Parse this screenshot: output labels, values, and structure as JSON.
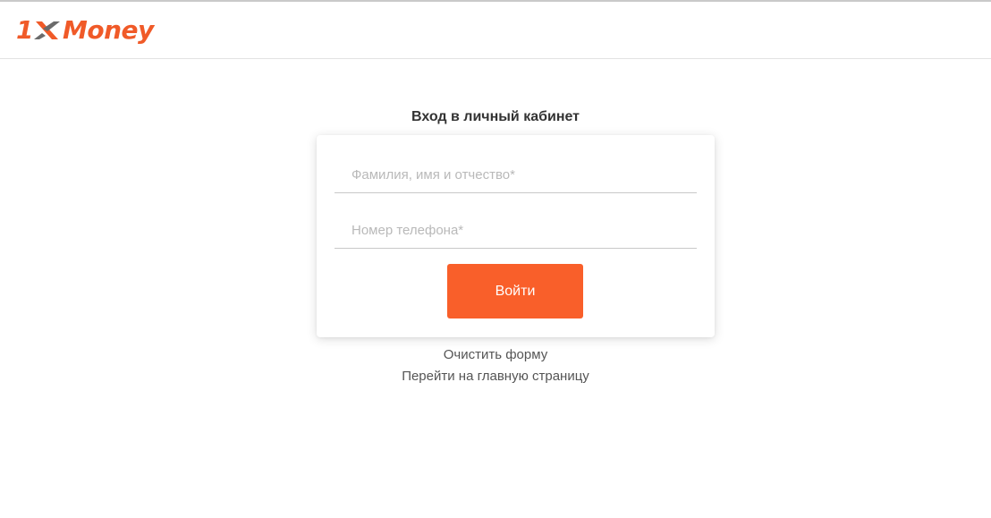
{
  "header": {
    "logo": {
      "prefix": "1",
      "brand": "Money",
      "color": "#f05a28"
    }
  },
  "login": {
    "title": "Вход в личный кабинет",
    "name_placeholder": "Фамилия, имя и отчество*",
    "name_value": "",
    "phone_placeholder": "Номер телефона*",
    "phone_value": "",
    "submit_label": "Войти",
    "submit_color": "#f95f2a"
  },
  "links": {
    "clear_form": "Очистить форму",
    "go_home": "Перейти на главную страницу"
  }
}
